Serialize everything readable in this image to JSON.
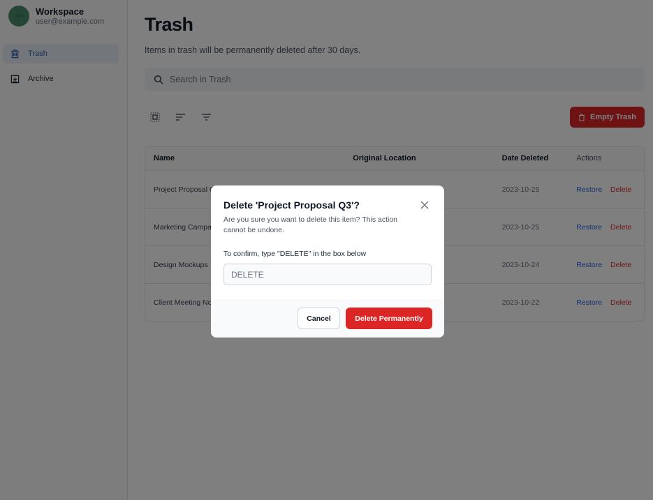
{
  "workspace": {
    "name": "Workspace",
    "email": "user@example.com"
  },
  "sidebar": {
    "items": [
      {
        "label": "Trash",
        "icon": "trash-icon",
        "active": true
      },
      {
        "label": "Archive",
        "icon": "archive-icon",
        "active": false
      }
    ]
  },
  "page": {
    "title": "Trash",
    "subtitle": "Items in trash will be permanently deleted after 30 days."
  },
  "search": {
    "placeholder": "Search in Trash"
  },
  "toolbar": {
    "empty_label": "Empty Trash"
  },
  "table": {
    "columns": [
      "Name",
      "Original Location",
      "Date Deleted",
      "Actions"
    ],
    "rows": [
      {
        "name": "Project Proposal Q3",
        "location": "",
        "date": "2023-10-26"
      },
      {
        "name": "Marketing Campaign",
        "location": "",
        "date": "2023-10-25"
      },
      {
        "name": "Design Mockups",
        "location": "",
        "date": "2023-10-24"
      },
      {
        "name": "Client Meeting Notes",
        "location": "",
        "date": "2023-10-22"
      }
    ],
    "restore_label": "Restore",
    "delete_label": "Delete"
  },
  "modal": {
    "title": "Delete 'Project Proposal Q3'?",
    "description": "Are you sure you want to delete this item? This action cannot be undone.",
    "confirm_label": "To confirm, type \"DELETE\" in the box below",
    "input_value": "DELETE",
    "cancel_label": "Cancel",
    "confirm_button": "Delete Permanently"
  },
  "colors": {
    "accent": "#2563eb",
    "danger": "#dc2626",
    "active_nav_bg": "#e7eef9"
  }
}
